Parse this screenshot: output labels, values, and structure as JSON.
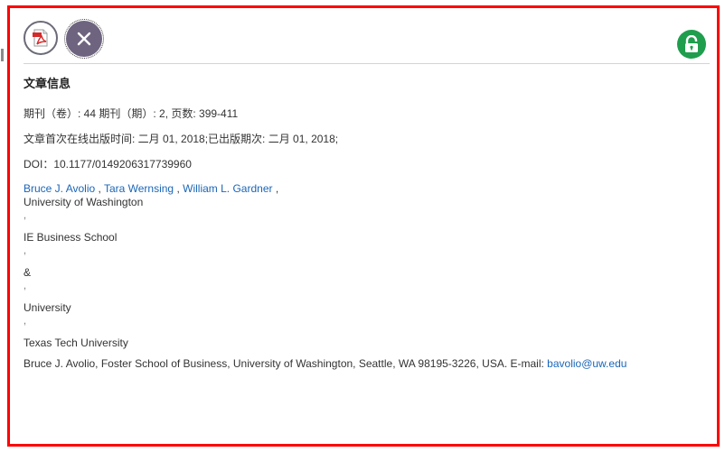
{
  "toolbar": {
    "pdf_icon": "pdf-icon",
    "close_icon": "close-icon",
    "open_access_icon": "unlocked-padlock-icon",
    "colors": {
      "close_bg": "#6e6480",
      "lock_bg": "#1f9e4e",
      "frame": "#ff0000"
    }
  },
  "article": {
    "section_title": "文章信息",
    "volume_issue": "期刊（卷）: 44 期刊（期）: 2, 页数: 399-411",
    "online_date": "文章首次在线出版时间: 二月 01, 2018;已出版期次:  二月 01, 2018;",
    "doi": "DOI：10.1177/0149206317739960",
    "authors": [
      {
        "name": "Bruce J. Avolio",
        "sep": " , "
      },
      {
        "name": "Tara Wernsing",
        "sep": " , "
      },
      {
        "name": "William L. Gardner",
        "sep": " ,"
      }
    ],
    "affiliations": [
      {
        "text": "University of Washington",
        "comma": ","
      },
      {
        "text": "IE Business School",
        "comma": ","
      },
      {
        "text": "&",
        "comma": ","
      },
      {
        "text": "University",
        "comma": ","
      },
      {
        "text": "Texas Tech University",
        "comma": ""
      }
    ],
    "contact_prefix": "Bruce J. Avolio, Foster School of Business, University of Washington, Seattle, WA 98195-3226, USA. E-mail: ",
    "contact_email": "bavolio@uw.edu",
    "link_color": "#1a66b8"
  }
}
